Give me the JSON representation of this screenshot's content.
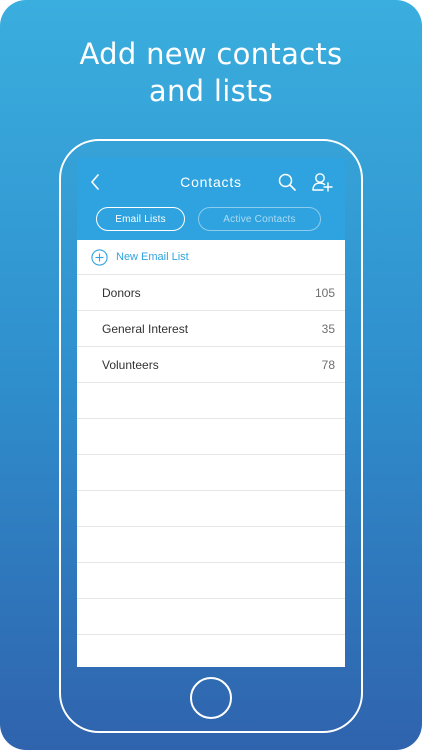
{
  "headline": {
    "line1": "Add new contacts",
    "line2": "and lists"
  },
  "app": {
    "title": "Contacts",
    "tabs": [
      {
        "label": "Email Lists",
        "active": true
      },
      {
        "label": "Active Contacts",
        "active": false
      }
    ],
    "new_list_label": "New Email List",
    "lists": [
      {
        "name": "Donors",
        "count": "105"
      },
      {
        "name": "General Interest",
        "count": "35"
      },
      {
        "name": "Volunteers",
        "count": "78"
      }
    ],
    "icons": {
      "back": "chevron-left-icon",
      "search": "search-icon",
      "add_contact": "add-person-icon",
      "new_list": "plus-circle-icon"
    }
  },
  "colors": {
    "bg_top": "#3aaede",
    "bg_bottom": "#2f63ad",
    "appbar": "#2fa3df",
    "accent_text": "#2fa3df"
  }
}
